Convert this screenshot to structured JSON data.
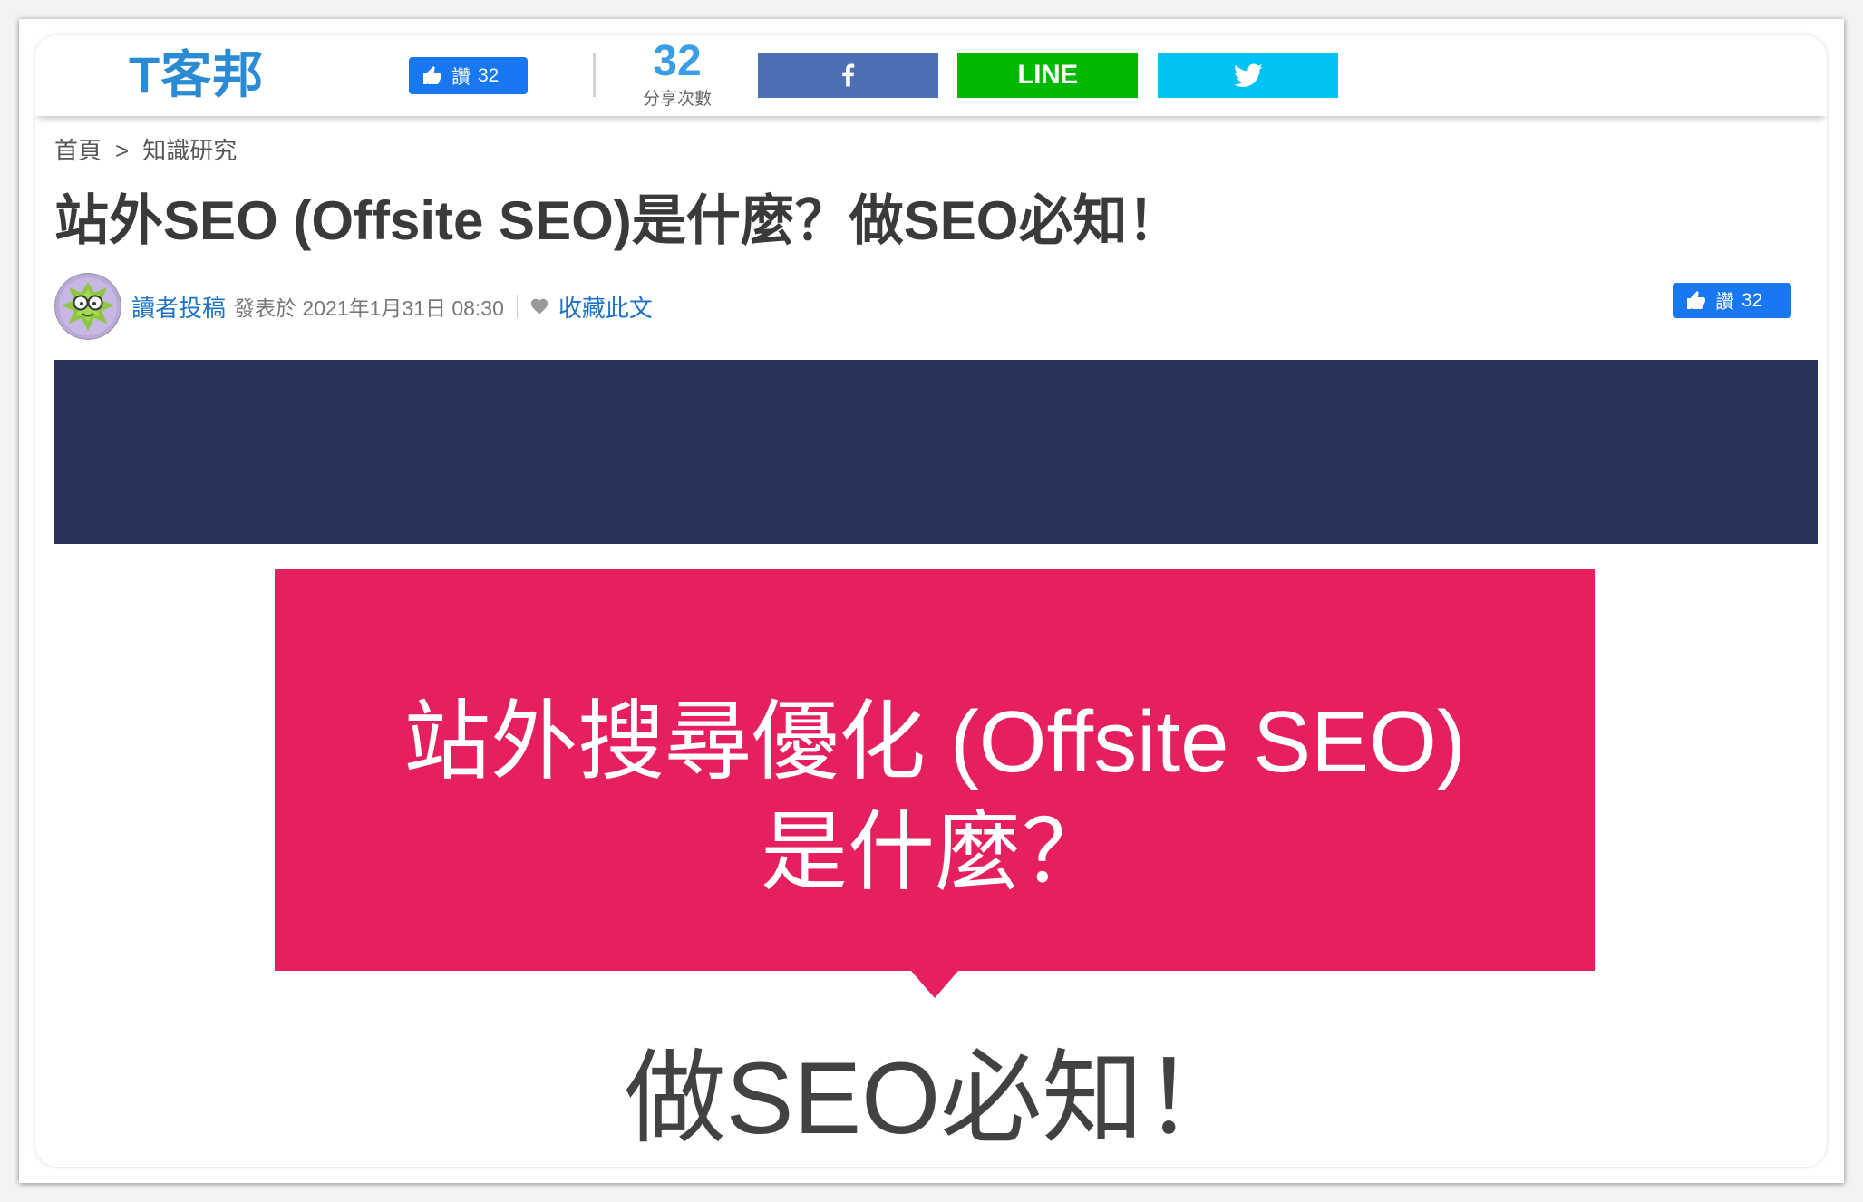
{
  "header": {
    "logo_text": "T客邦",
    "like_button": {
      "icon": "thumbs-up-icon",
      "label": "讚",
      "count": "32",
      "color": "#1877f2"
    },
    "share_count": {
      "value": "32",
      "label": "分享次數"
    },
    "share_buttons": [
      {
        "icon": "facebook-icon",
        "color": "#4b6eb4"
      },
      {
        "label": "LINE",
        "color": "#00b900"
      },
      {
        "icon": "twitter-icon",
        "color": "#00c3f5"
      }
    ]
  },
  "breadcrumb": {
    "items": [
      "首頁",
      "知識研究"
    ],
    "separator": ">"
  },
  "article": {
    "title": "站外SEO (Offsite SEO)是什麼？做SEO必知！",
    "author": "讀者投稿",
    "published": "發表於 2021年1月31日 08:30",
    "favorite": {
      "icon": "heart-icon",
      "label": "收藏此文"
    },
    "like_button": {
      "icon": "thumbs-up-icon",
      "label": "讚",
      "count": "32",
      "color": "#1877f2"
    },
    "hero": {
      "banner_color": "#29335b",
      "card_color": "#e6205f",
      "card_lines": [
        "站外搜尋優化 (Offsite SEO)",
        "是什麼？"
      ],
      "caption": "做SEO必知！"
    }
  },
  "colors": {
    "brand_blue": "#2a8ad4",
    "link_blue": "#1d72c4",
    "title_text": "#3a3a3a",
    "share_count_blue": "#3a9ee4",
    "caption_text": "#424242"
  }
}
